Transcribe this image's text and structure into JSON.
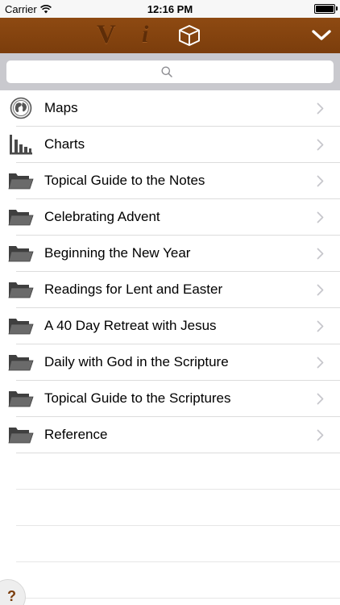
{
  "status": {
    "carrier": "Carrier",
    "time": "12:16 PM"
  },
  "nav": {
    "title_v": "V",
    "title_i": "i"
  },
  "search": {
    "placeholder": "",
    "value": ""
  },
  "rows": [
    {
      "label": "Maps",
      "icon": "globe-icon"
    },
    {
      "label": "Charts",
      "icon": "bar-chart-icon"
    },
    {
      "label": "Topical Guide to the Notes",
      "icon": "folder-icon"
    },
    {
      "label": "Celebrating Advent",
      "icon": "folder-icon"
    },
    {
      "label": "Beginning the New Year",
      "icon": "folder-icon"
    },
    {
      "label": "Readings for Lent and Easter",
      "icon": "folder-icon"
    },
    {
      "label": "A 40 Day Retreat with Jesus",
      "icon": "folder-icon"
    },
    {
      "label": "Daily with God in the Scripture",
      "icon": "folder-icon"
    },
    {
      "label": "Topical Guide to the Scriptures",
      "icon": "folder-icon"
    },
    {
      "label": "Reference",
      "icon": "folder-icon"
    }
  ],
  "help": {
    "label": "?"
  },
  "colors": {
    "nav_brown": "#7b3d0c",
    "search_bar": "#c9c9ce",
    "folder_gray": "#5a5a5a"
  }
}
